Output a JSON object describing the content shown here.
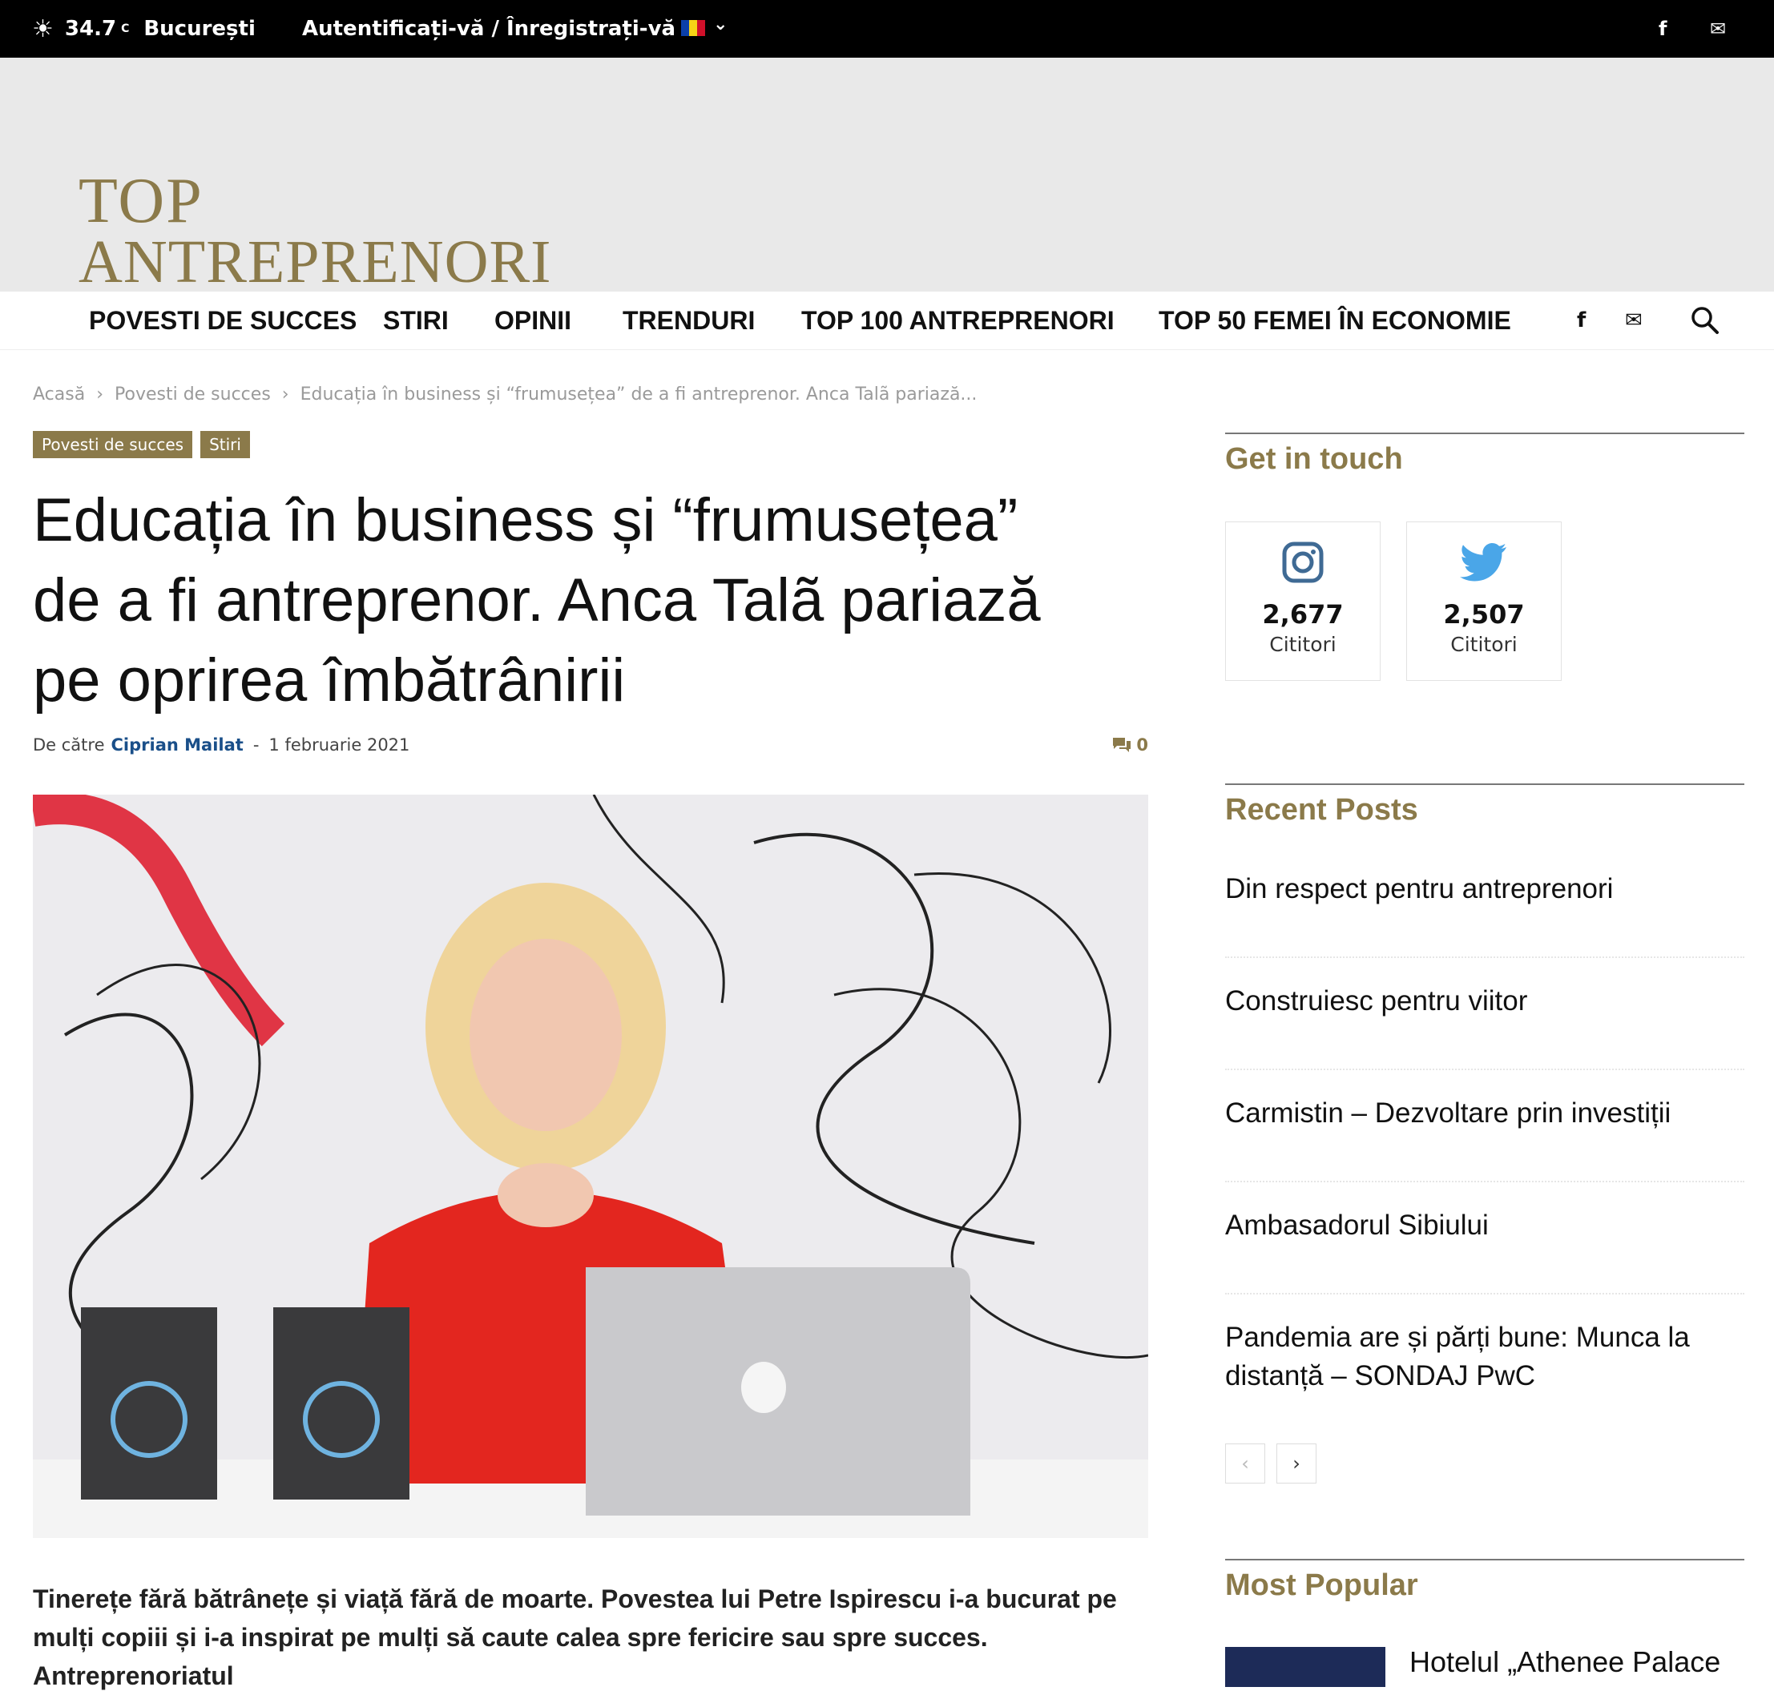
{
  "topbar": {
    "temperature": "34.7",
    "unit": "C",
    "city": "București",
    "login": "Autentificați-vă / Înregistrați-vă",
    "flag_colors": [
      "#0b3fa8",
      "#f6d216",
      "#d0102a"
    ],
    "social": [
      "facebook-icon",
      "mail-icon"
    ]
  },
  "logo": {
    "line1": "TOP",
    "line2": "ANTREPRENORI",
    "color": "#8b7a4a"
  },
  "nav": {
    "items": [
      "POVESTI DE SUCCES",
      "STIRI",
      "OPINII",
      "TRENDURI",
      "TOP 100 ANTREPRENORI",
      "TOP 50 FEMEI ÎN ECONOMIE"
    ]
  },
  "breadcrumb": {
    "items": [
      "Acasă",
      "Povesti de succes",
      "Educația în business și “frumusețea” de a fi antreprenor. Anca Talã pariază..."
    ],
    "separator": "›"
  },
  "article": {
    "tags": [
      "Povesti de succes",
      "Stiri"
    ],
    "title_lines": [
      "Educația în business și “frumusețea”",
      "de a fi antreprenor. Anca Talã pariază",
      "pe oprirea îmbătrânirii"
    ],
    "byline_prefix": "De către",
    "author": "Ciprian Mailat",
    "dash": "-",
    "date": "1 februarie 2021",
    "comments": "0",
    "intro_lines": [
      "Tinerețe fără bătrânețe și viață fără de moarte. Povestea lui Petre Ispirescu i-a bucurat pe",
      "mulți copiii și i-a inspirat pe mulți să caute calea spre fericire sau spre succes. Antreprenoriatul"
    ]
  },
  "sidebar": {
    "get_in_touch": "Get in touch",
    "social_counters": [
      {
        "icon": "instagram-icon",
        "count": "2,677",
        "label": "Cititori"
      },
      {
        "icon": "twitter-icon",
        "count": "2,507",
        "label": "Cititori"
      }
    ],
    "recent_title": "Recent Posts",
    "recent_posts": [
      [
        "Din respect pentru antreprenori"
      ],
      [
        "Construiesc pentru viitor"
      ],
      [
        "Carmistin – Dezvoltare prin investiții"
      ],
      [
        "Ambasadorul Sibiului"
      ],
      [
        "Pandemia are și părți bune: Munca la",
        "distanță – SONDAJ PwC"
      ]
    ],
    "pager": {
      "prev": "‹",
      "next": "›"
    },
    "popular_title": "Most Popular",
    "popular_first": "Hotelul „Athenee Palace"
  }
}
